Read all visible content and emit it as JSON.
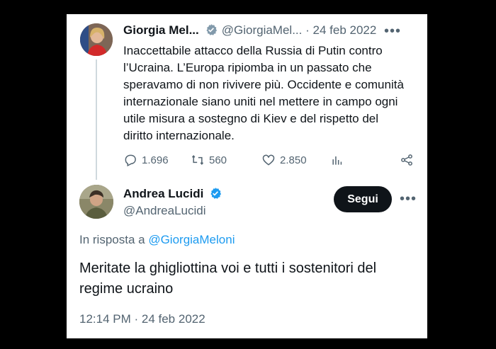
{
  "original_tweet": {
    "author_name": "Giorgia Mel...",
    "handle": "@GiorgiaMel...",
    "separator": "·",
    "date": "24 feb 2022",
    "more": "•••",
    "text": "Inaccettabile attacco della Russia di Putin contro l’Ucraina. L’Europa ripiomba in un passato che speravamo di non rivivere più. Occidente e comunità internazionale siano uniti nel mettere in campo ogni utile misura a sostegno di Kiev e del rispetto del diritto internazionale.",
    "actions": {
      "replies": "1.696",
      "retweets": "560",
      "likes": "2.850"
    }
  },
  "reply_tweet": {
    "author_name": "Andrea Lucidi",
    "handle": "@AndreaLucidi",
    "follow_label": "Segui",
    "more": "•••",
    "reply_prefix": "In risposta a ",
    "reply_to_handle": "@GiorgiaMeloni",
    "text": "Meritate la ghigliottina voi e tutti i sostenitori del regime ucraino",
    "timestamp": "12:14 PM · 24 feb 2022"
  },
  "colors": {
    "verified_badge": "#1d9bf0",
    "link": "#1d9bf0",
    "muted": "#536471",
    "follow_button_bg": "#0f1419"
  },
  "icons": [
    "verified-icon",
    "reply-icon",
    "retweet-icon",
    "like-icon",
    "views-icon",
    "share-icon",
    "more-icon"
  ]
}
